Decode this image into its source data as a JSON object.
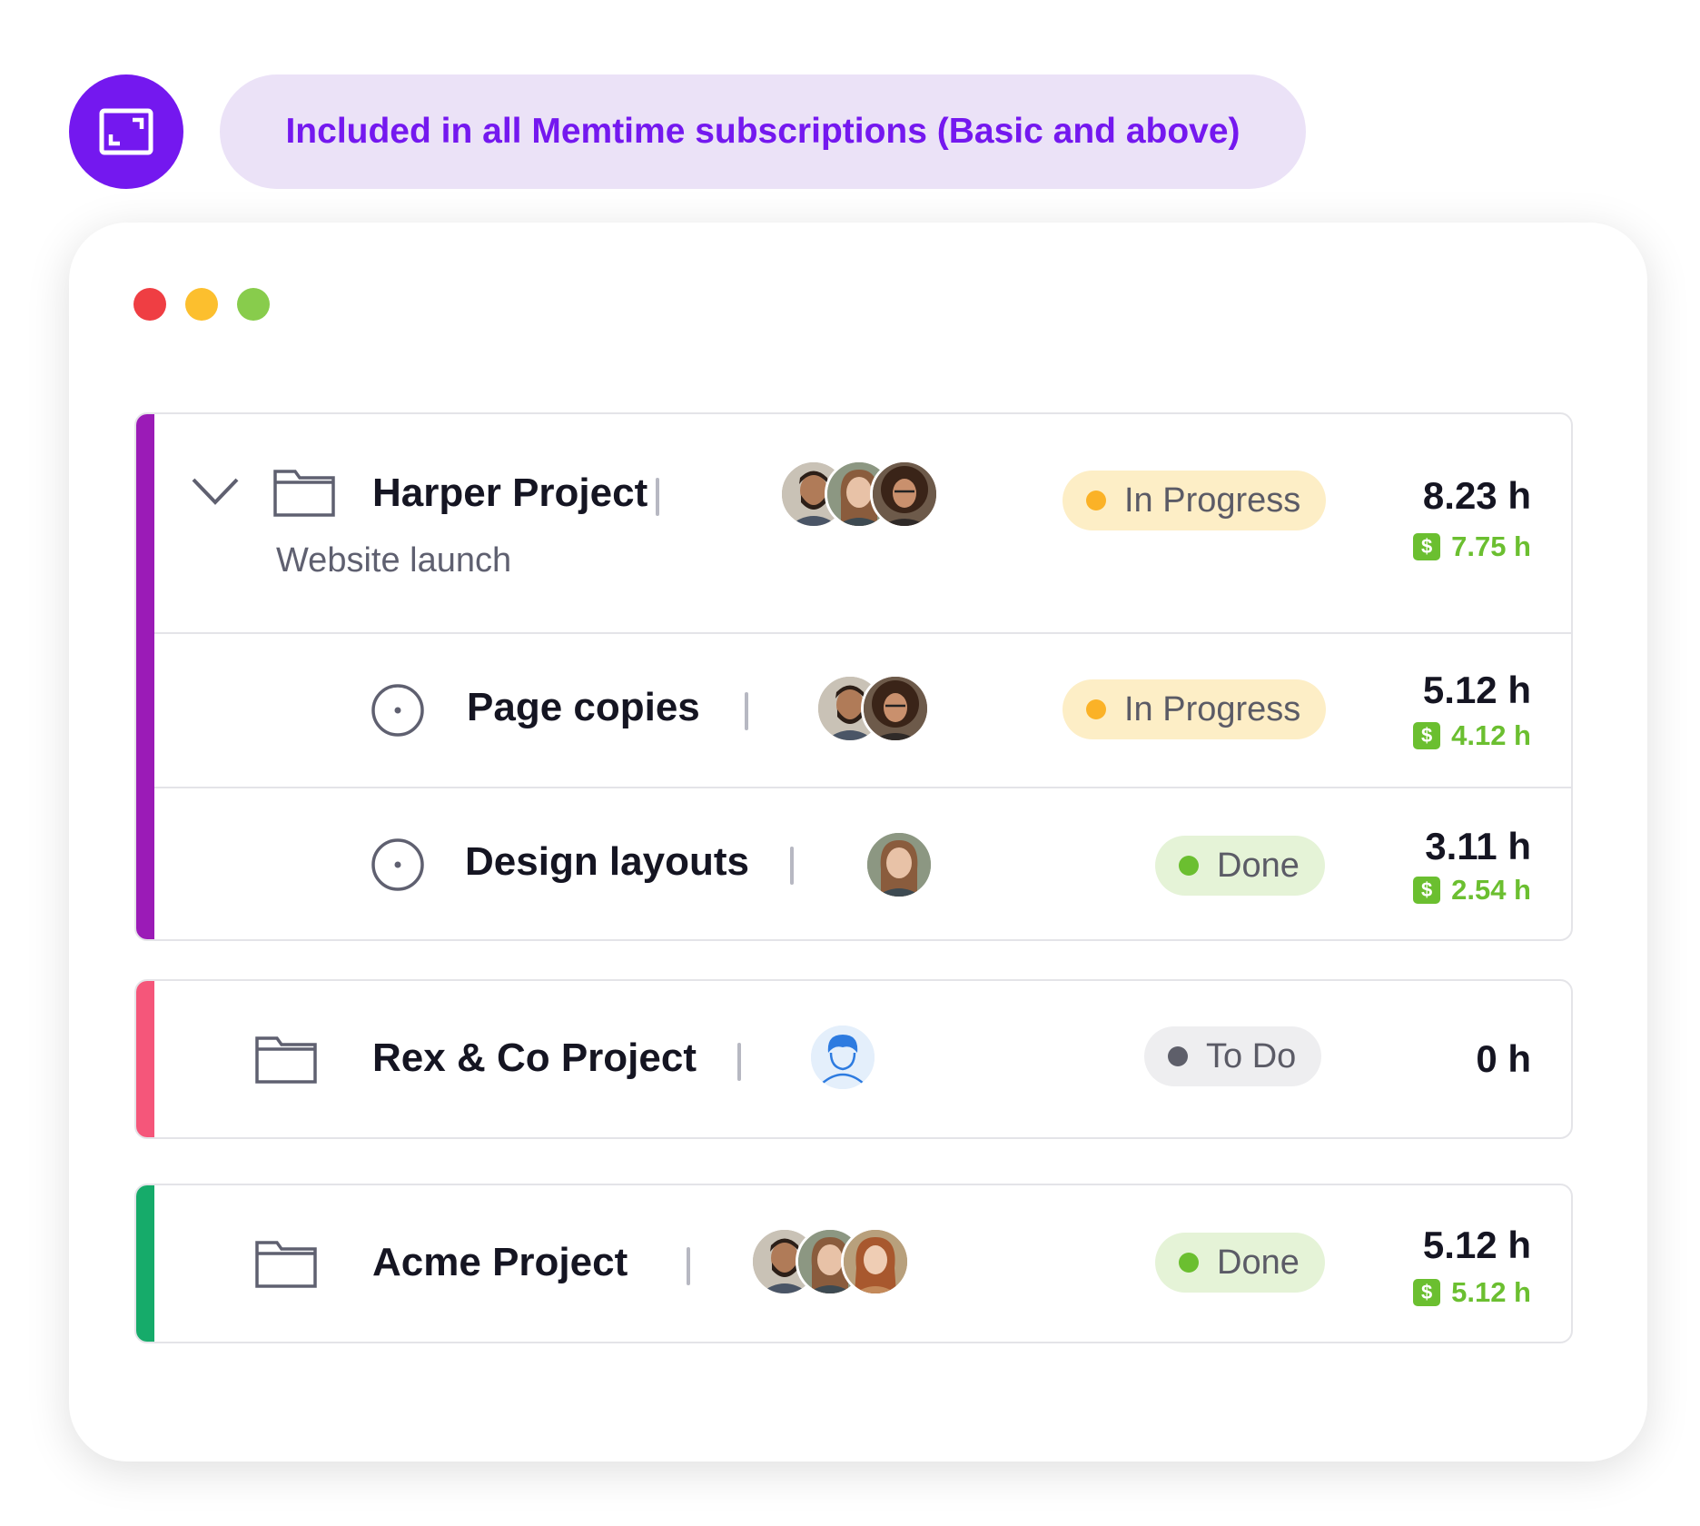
{
  "banner": {
    "text": "Included in all Memtime subscriptions (Basic and above)",
    "icon": "expand-frame-icon",
    "accent": "#7418ef"
  },
  "window_controls": [
    "#ef3e43",
    "#fcbf2e",
    "#88cc4c"
  ],
  "projects": [
    {
      "name": "Harper Project",
      "subtitle": "Website launch",
      "color": "#9b1bb7",
      "expanded": true,
      "avatars": [
        "man-beard",
        "woman-light",
        "woman-curly"
      ],
      "status": "In Progress",
      "hours": "8.23 h",
      "billable": "7.75 h",
      "tasks": [
        {
          "name": "Page copies",
          "avatars": [
            "man-beard",
            "woman-curly"
          ],
          "status": "In Progress",
          "hours": "5.12 h",
          "billable": "4.12 h"
        },
        {
          "name": "Design layouts",
          "avatars": [
            "woman-light"
          ],
          "status": "Done",
          "hours": "3.11 h",
          "billable": "2.54 h"
        }
      ]
    },
    {
      "name": "Rex & Co Project",
      "color": "#f5567a",
      "avatars": [
        "placeholder-user-icon"
      ],
      "status": "To Do",
      "hours": "0 h"
    },
    {
      "name": "Acme Project",
      "color": "#16ab6a",
      "avatars": [
        "man-beard",
        "woman-light",
        "woman-red-hair"
      ],
      "status": "Done",
      "hours": "5.12 h",
      "billable": "5.12 h"
    }
  ],
  "billable_symbol": "$",
  "status_styles": {
    "In Progress": {
      "bg": "#fdeec6",
      "dot": "#fbb227",
      "text": "#5b5b66"
    },
    "Done": {
      "bg": "#e5f3d7",
      "dot": "#6bbf30",
      "text": "#5b5b66"
    },
    "To Do": {
      "bg": "#eeeef0",
      "dot": "#5e5f6a",
      "text": "#5b5b66"
    }
  }
}
